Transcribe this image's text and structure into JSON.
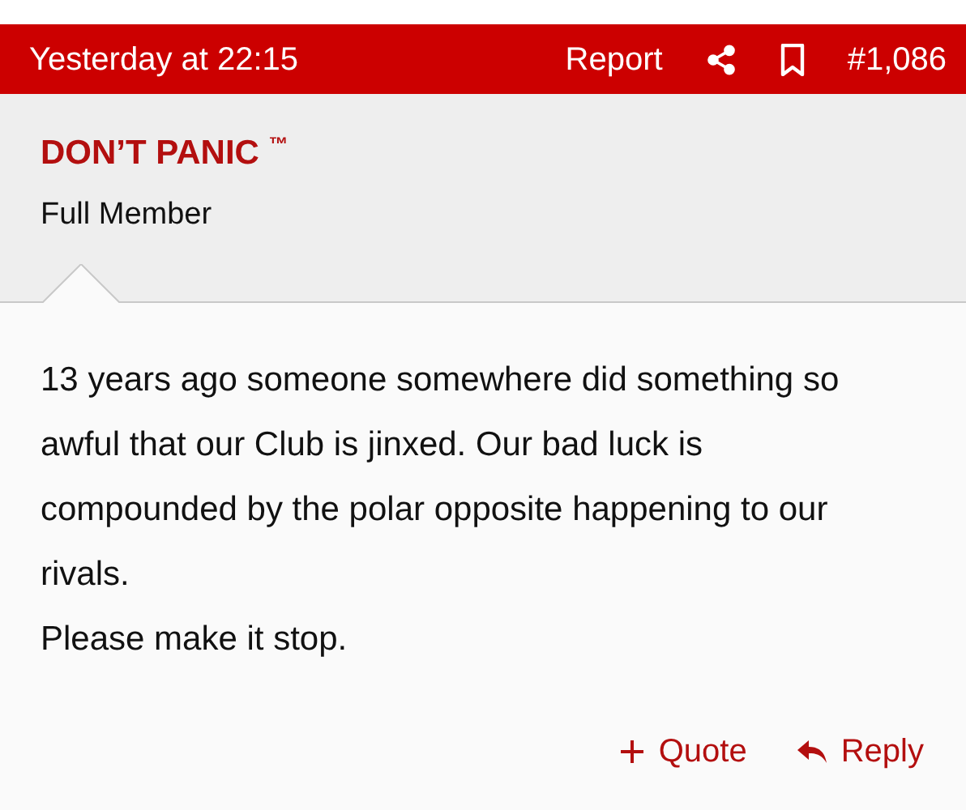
{
  "header": {
    "time": "Yesterday at 22:15",
    "report": "Report",
    "post_number": "#1,086"
  },
  "author": {
    "name": "DON’T PANIC $^{™}$",
    "title": "Full Member"
  },
  "body": [
    "13 years ago someone somewhere did something so awful that our Club is jinxed. Our bad luck is compounded by the polar opposite happening to our rivals.",
    "Please make it stop."
  ],
  "actions": [
    {
      "kind": "quote",
      "label": "Quote"
    },
    {
      "kind": "reply",
      "label": "Reply"
    }
  ]
}
